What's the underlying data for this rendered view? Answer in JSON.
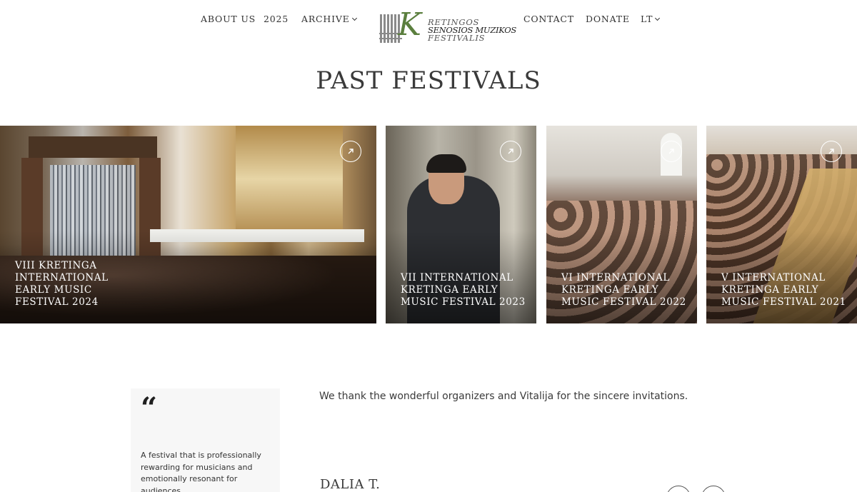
{
  "nav": {
    "left": [
      {
        "label": "ABOUT US"
      },
      {
        "label": "2025"
      },
      {
        "label": "ARCHIVE"
      }
    ],
    "right": [
      {
        "label": "CONTACT"
      },
      {
        "label": "DONATE"
      },
      {
        "label": "LT"
      }
    ]
  },
  "logo": {
    "big_letter": "K",
    "line1": "retingos",
    "line2": "senosios muzikos",
    "line3": "festivalis"
  },
  "section": {
    "heading": "PAST FESTIVALS"
  },
  "festivals": [
    {
      "title": "VIII KRETINGA INTERNATIONAL EARLY MUSIC FESTIVAL 2024",
      "icon": "arrow-up-right-icon"
    },
    {
      "title": "VII INTERNATIONAL KRETINGA EARLY MUSIC FESTIVAL 2023",
      "icon": "arrow-up-right-icon"
    },
    {
      "title": "VI INTERNATIONAL KRETINGA EARLY MUSIC FESTIVAL 2022",
      "icon": "arrow-up-right-icon"
    },
    {
      "title": "V INTERNATIONAL KRETINGA EARLY MUSIC FESTIVAL 2021",
      "icon": "arrow-up-right-icon"
    }
  ],
  "testimonial": {
    "quote_mark": "“",
    "quote_text": "A festival that is professionally rewarding for musicians and emotionally resonant for audiences.",
    "thanks": "We thank the wonderful organizers and Vitalija for the sincere invitations.",
    "author": "DALIA T."
  },
  "colors": {
    "logo_green": "#5b7f3e",
    "text_dark": "#3a3a3a",
    "quote_bg": "#f7f7f7"
  }
}
